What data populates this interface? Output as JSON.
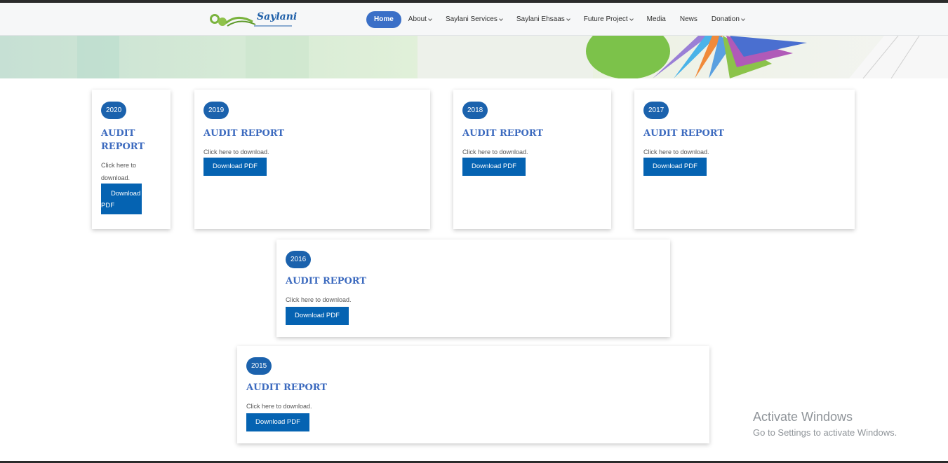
{
  "header": {
    "logo_text": "Saylani",
    "nav": [
      {
        "label": "Home",
        "active": true,
        "caret": false
      },
      {
        "label": "About",
        "active": false,
        "caret": true
      },
      {
        "label": "Saylani Services",
        "active": false,
        "caret": true
      },
      {
        "label": "Saylani Ehsaas",
        "active": false,
        "caret": true
      },
      {
        "label": "Future Project",
        "active": false,
        "caret": true
      },
      {
        "label": "Media",
        "active": false,
        "caret": false
      },
      {
        "label": "News",
        "active": false,
        "caret": false
      },
      {
        "label": "Donation",
        "active": false,
        "caret": true
      }
    ]
  },
  "reports": [
    {
      "year": "2020",
      "title": "AUDIT REPORT",
      "description": "Click here to download.",
      "button": "Download PDF"
    },
    {
      "year": "2019",
      "title": "AUDIT REPORT",
      "description": "Click here to download.",
      "button": "Download PDF"
    },
    {
      "year": "2018",
      "title": "AUDIT REPORT",
      "description": "Click here to download.",
      "button": "Download PDF"
    },
    {
      "year": "2017",
      "title": "AUDIT REPORT",
      "description": "Click here to download.",
      "button": "Download PDF"
    },
    {
      "year": "2016",
      "title": "AUDIT REPORT",
      "description": "Click here to download.",
      "button": "Download PDF"
    },
    {
      "year": "2015",
      "title": "AUDIT REPORT",
      "description": "Click here to download.",
      "button": "Download PDF"
    }
  ],
  "watermark": {
    "line1": "Activate Windows",
    "line2": "Go to Settings to activate Windows."
  },
  "colors": {
    "accent": "#0563b2",
    "nav_active": "#3a6fc7",
    "title": "#3d6bbf",
    "logo_green": "#7ab33e"
  }
}
